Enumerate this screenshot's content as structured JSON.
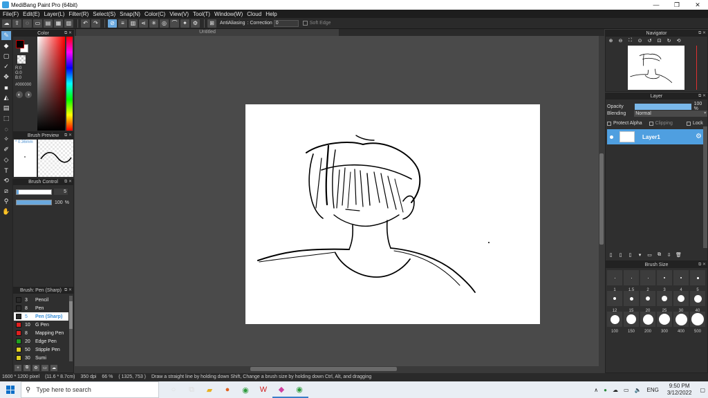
{
  "window": {
    "title": "MediBang Paint Pro (64bit)",
    "controls": [
      "—",
      "❐",
      "✕"
    ]
  },
  "menu": [
    "File(F)",
    "Edit(E)",
    "Layer(L)",
    "Filter(R)",
    "Select(S)",
    "Snap(N)",
    "Color(C)",
    "View(V)",
    "Tool(T)",
    "Window(W)",
    "Cloud",
    "Help"
  ],
  "toolbar": {
    "antialiasing_label": "AntiAliasing",
    "correction_label": ": Correction",
    "correction_value": "0",
    "soft_edge_label": "Soft Edge"
  },
  "color_panel": {
    "title": "Color",
    "r": "R:0",
    "g": "G:0",
    "b": "B:0",
    "hex": "#000000",
    "fg": "#000000",
    "bg": "#ffffff"
  },
  "brush_preview": {
    "title": "Brush Preview",
    "size": "* 0.36mm"
  },
  "brush_control": {
    "title": "Brush Control",
    "size_value": "5",
    "opacity_value": "100",
    "opacity_unit": "%",
    "size_fraction": 0.05,
    "opacity_fraction": 1.0
  },
  "brush_list": {
    "title": "Brush: Pen (Sharp)",
    "items": [
      {
        "num": "3",
        "name": "Pencil",
        "color": "#2a2a2a",
        "selected": false
      },
      {
        "num": "8",
        "name": "Pen",
        "color": "#2a2a2a",
        "selected": false
      },
      {
        "num": "5",
        "name": "Pen (Sharp)",
        "color": "#2a2a2a",
        "selected": true
      },
      {
        "num": "10",
        "name": "G Pen",
        "color": "#e02020",
        "selected": false
      },
      {
        "num": "8",
        "name": "Mapping Pen",
        "color": "#e02020",
        "selected": false
      },
      {
        "num": "20",
        "name": "Edge Pen",
        "color": "#20a020",
        "selected": false
      },
      {
        "num": "50",
        "name": "Stipple Pen",
        "color": "#e0d020",
        "selected": false
      },
      {
        "num": "30",
        "name": "Sumi",
        "color": "#e0d020",
        "selected": false
      }
    ]
  },
  "canvas": {
    "tab_title": "Untitled"
  },
  "navigator": {
    "title": "Navigator"
  },
  "layer_panel": {
    "title": "Layer",
    "opacity_label": "Opacity",
    "opacity_value": "100 %",
    "blending_label": "Blending",
    "blending_value": "Normal",
    "protect_alpha": "Protect Alpha",
    "clipping": "Clipping",
    "lock": "Lock",
    "layer_name": "Layer1"
  },
  "brush_size": {
    "title": "Brush Size",
    "rows": [
      [
        "1",
        "1.5",
        "2",
        "3",
        "4",
        "5"
      ],
      [
        "12",
        "15",
        "20",
        "25",
        "30",
        "40"
      ],
      [
        "100",
        "150",
        "200",
        "300",
        "400",
        "500"
      ]
    ]
  },
  "status": {
    "dimensions": "1600 * 1200 pixel",
    "physical": "(11.6 * 8.7cm)",
    "dpi": "350 dpi",
    "zoom": "66 %",
    "cursor": "( 1325, 753 )",
    "hint": "Draw a straight line by holding down Shift, Change a brush size by holding down Ctrl, Alt, and dragging"
  },
  "taskbar": {
    "search_placeholder": "Type here to search",
    "lang": "ENG",
    "time": "9:50 PM",
    "date": "3/12/2022"
  }
}
